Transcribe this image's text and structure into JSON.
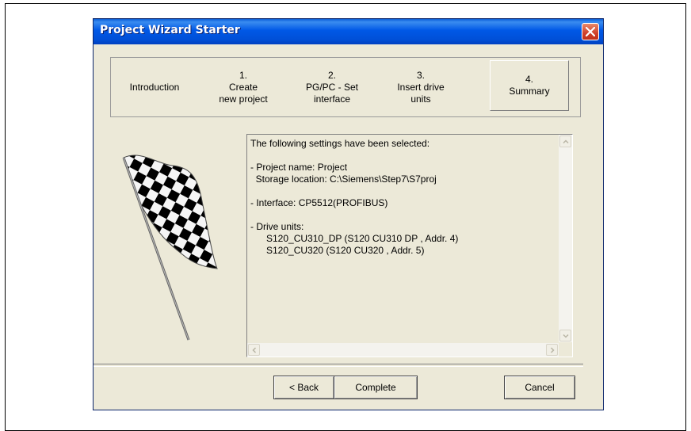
{
  "window": {
    "title": "Project Wizard Starter",
    "close_icon": "close-icon"
  },
  "steps": [
    {
      "number": "",
      "label": "Introduction",
      "active": false
    },
    {
      "number": "1.",
      "label": "Create\nnew project",
      "active": false
    },
    {
      "number": "2.",
      "label": "PG/PC - Set\ninterface",
      "active": false
    },
    {
      "number": "3.",
      "label": "Insert drive\nunits",
      "active": false
    },
    {
      "number": "4.",
      "label": "Summary",
      "active": true
    }
  ],
  "summary": {
    "heading": "The following settings have been selected:",
    "project_name": "- Project name: Project",
    "storage_location": "  Storage location: C:\\Siemens\\Step7\\S7proj",
    "interface": "- Interface: CP5512(PROFIBUS)",
    "drive_units_label": "- Drive units:",
    "drive_unit_1": "S120_CU310_DP  (S120 CU310 DP , Addr. 4)",
    "drive_unit_2": "S120_CU320  (S120 CU320 , Addr. 5)"
  },
  "buttons": {
    "back": "< Back",
    "complete": "Complete",
    "cancel": "Cancel"
  },
  "image": {
    "flag_icon": "checkered-flag-icon"
  }
}
